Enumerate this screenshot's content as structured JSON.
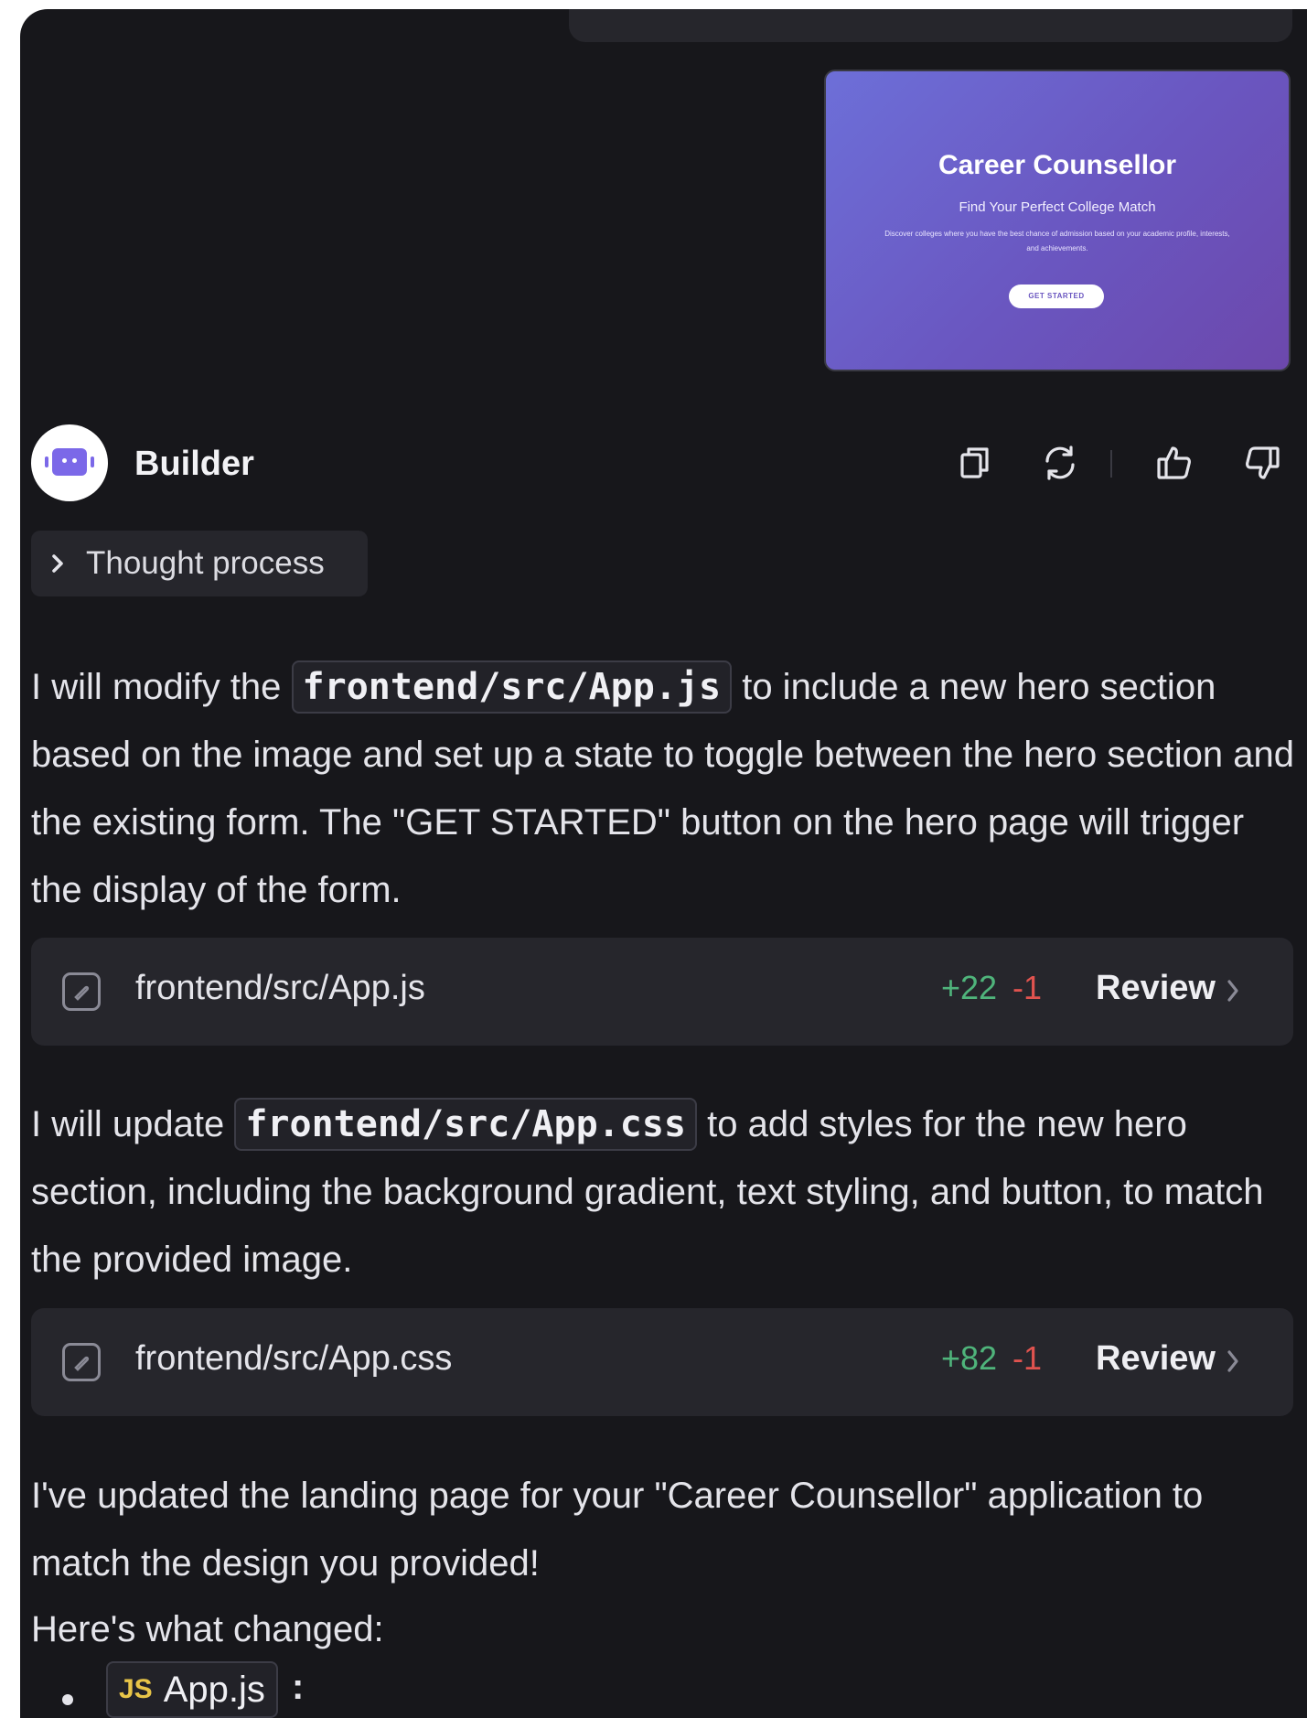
{
  "preview": {
    "title": "Career Counsellor",
    "subtitle": "Find Your Perfect College Match",
    "description": "Discover colleges where you have the best chance of admission based on your academic profile, interests, and achievements.",
    "button_label": "GET STARTED"
  },
  "agent": {
    "name": "Builder",
    "icons": [
      "copy-icon",
      "regenerate-icon",
      "thumbs-up-icon",
      "thumbs-down-icon"
    ]
  },
  "thought": {
    "label": "Thought process"
  },
  "messages": {
    "p1_before": "I will modify the ",
    "p1_code": "frontend/src/App.js",
    "p1_after": " to include a new hero section based on the image and set up a state to toggle between the hero section and the existing form. The \"GET STARTED\" button on the hero page will trigger the display of the form.",
    "p2_before": "I will update ",
    "p2_code": "frontend/src/App.css",
    "p2_after": " to add styles for the new hero section, including the background gradient, text styling, and button, to match the provided image.",
    "p3": "I've updated the landing page for your \"Career Counsellor\" application to match the design you provided!",
    "p4": "Here's what changed:"
  },
  "files": [
    {
      "name": "frontend/src/App.js",
      "added": "+22",
      "removed": "-1",
      "action": "Review"
    },
    {
      "name": "frontend/src/App.css",
      "added": "+82",
      "removed": "-1",
      "action": "Review"
    }
  ],
  "bullets": [
    {
      "badge": "JS",
      "file": "App.js",
      "suffix": ":"
    }
  ],
  "colors": {
    "panel_bg": "#17171b",
    "card_bg": "#26262c",
    "added": "#4fb47b",
    "removed": "#e0534f",
    "accent": "#7b68e8",
    "js_badge": "#e8c548"
  }
}
